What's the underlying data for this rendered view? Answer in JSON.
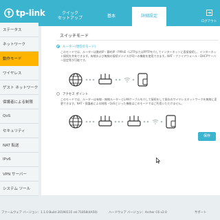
{
  "header": {
    "brand": "tp-link",
    "tabs": [
      {
        "label": "クイック\nセットアップ",
        "active": false
      },
      {
        "label": "基本",
        "active": false
      },
      {
        "label": "詳細設定",
        "active": true
      }
    ],
    "logout_label": "ログアウト",
    "accent_color": "#3bb4cf"
  },
  "sidebar": {
    "items": [
      {
        "label": "ステータス",
        "active": false
      },
      {
        "label": "ネットワーク",
        "active": false
      },
      {
        "label": "動作モード",
        "active": true
      },
      {
        "label": "ワイヤレス",
        "active": false
      },
      {
        "label": "ゲスト ネットワーク",
        "active": false
      },
      {
        "label": "保護者による制限",
        "active": false
      },
      {
        "label": "QoS",
        "active": false
      },
      {
        "label": "セキュリティ",
        "active": false
      },
      {
        "label": "NAT 転送",
        "active": false
      },
      {
        "label": "IPv6",
        "active": false
      },
      {
        "label": "VPN サーバー",
        "active": false
      },
      {
        "label": "システム ツール",
        "active": false
      }
    ],
    "active_color": "#ffb500"
  },
  "main": {
    "section_title": "スイッチモード",
    "options": [
      {
        "label": "ルーター(現在のモード)",
        "selected": true,
        "description": "このモードでは、ルーターは動的IP・静的IP・PPPoE・L2TPまたはPPTPを介してインターネットに直接接続し、インターネット接続を共有できます。有線および無線の接続デバイスが同一の機能を使用できます。NAT・ファイアウォール・DHCPサーバー設定等が可能です。"
      },
      {
        "label": "アクセス ポイント",
        "selected": false,
        "description": "このモードでは、ルーターは有線・無線ルーターとLANケーブルを介して接続をして既存のワイヤレスネットワークを無線に変更できます。NAT・保護者による制限・QoSといった機能はこのモードではご利用いただけません。"
      }
    ],
    "save_label": "保存"
  },
  "footer": {
    "firmware": "ファームウェア バージョン：1.1.0 Build 20190115 rel.71858(4A50)",
    "hardware": "ハードウェア バージョン：Archer C6 v2.0",
    "support": "サポート"
  }
}
